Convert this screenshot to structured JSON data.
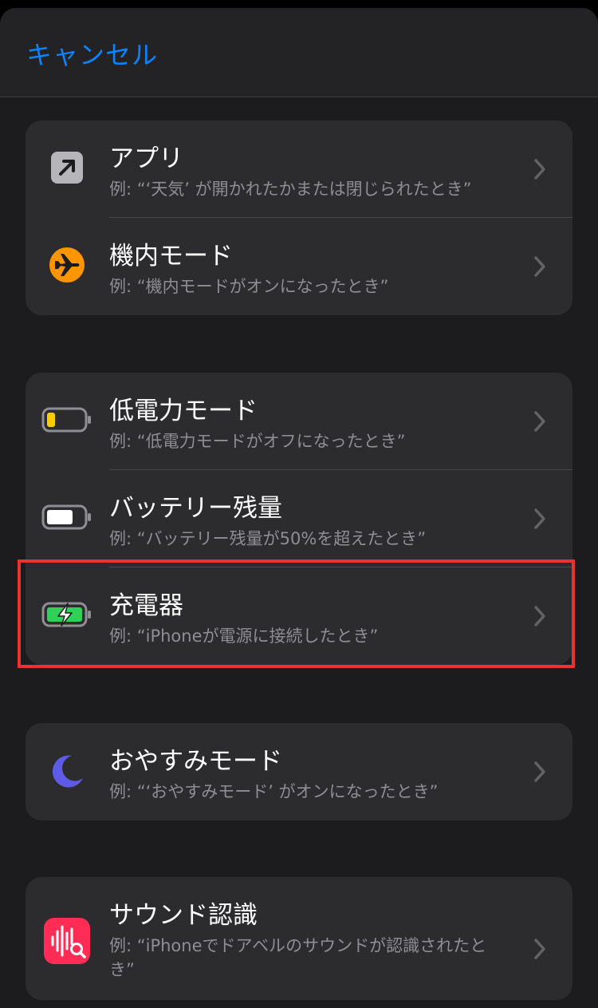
{
  "navbar": {
    "cancel_label": "キャンセル"
  },
  "groups": [
    {
      "items": [
        {
          "title": "アプリ",
          "subtitle": "例: “‘天気’ が開かれたかまたは閉じられたとき”",
          "icon": "app-arrow-icon"
        },
        {
          "title": "機内モード",
          "subtitle": "例: “機内モードがオンになったとき”",
          "icon": "airplane-icon"
        }
      ]
    },
    {
      "items": [
        {
          "title": "低電力モード",
          "subtitle": "例: “低電力モードがオフになったとき”",
          "icon": "battery-low-icon"
        },
        {
          "title": "バッテリー残量",
          "subtitle": "例: “バッテリー残量が50%を超えたとき”",
          "icon": "battery-full-icon"
        },
        {
          "title": "充電器",
          "subtitle": "例: “iPhoneが電源に接続したとき”",
          "icon": "battery-charging-icon"
        }
      ]
    },
    {
      "items": [
        {
          "title": "おやすみモード",
          "subtitle": "例: “‘おやすみモード’ がオンになったとき”",
          "icon": "moon-icon"
        }
      ]
    },
    {
      "items": [
        {
          "title": "サウンド認識",
          "subtitle": "例: “iPhoneでドアベルのサウンドが認識されたとき”",
          "icon": "sound-recognition-icon"
        }
      ]
    }
  ],
  "colors": {
    "accent": "#0a84ff",
    "highlight": "#e8342f",
    "airplane": "#ff9500",
    "battery_low": "#ffcc00",
    "battery_charging": "#30d158",
    "moon": "#5e5ce6",
    "sound": "#ff2d55"
  }
}
